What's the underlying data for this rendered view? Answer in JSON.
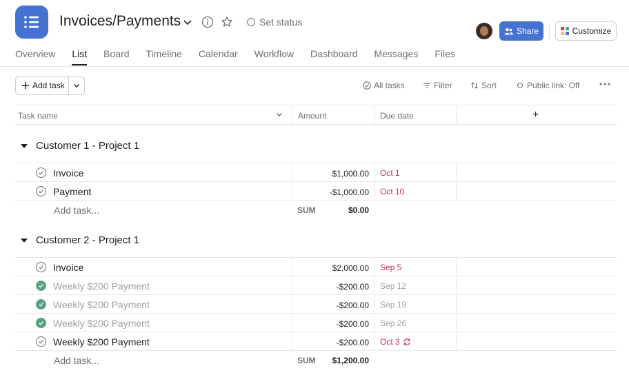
{
  "header": {
    "title": "Invoices/Payments",
    "set_status": "Set status",
    "share_label": "Share",
    "customize_label": "Customize",
    "accent_color": "#4573d2"
  },
  "tabs": [
    "Overview",
    "List",
    "Board",
    "Timeline",
    "Calendar",
    "Workflow",
    "Dashboard",
    "Messages",
    "Files"
  ],
  "active_tab": "List",
  "toolbar": {
    "add_task": "Add task",
    "all_tasks": "All tasks",
    "filter": "Filter",
    "sort": "Sort",
    "public_link": "Public link: Off"
  },
  "columns": {
    "task_name": "Task name",
    "amount": "Amount",
    "due_date": "Due date",
    "add_column": "+"
  },
  "sections": [
    {
      "title": "Customer 1 - Project 1",
      "tasks": [
        {
          "name": "Invoice",
          "amount": "$1,000.00",
          "due": "Oct 1",
          "done": false,
          "recurring": false
        },
        {
          "name": "Payment",
          "amount": "-$1,000.00",
          "due": "Oct 10",
          "done": false,
          "recurring": false
        }
      ],
      "add_task": "Add task...",
      "sum_label": "SUM",
      "sum_value": "$0.00"
    },
    {
      "title": "Customer 2 - Project 1",
      "tasks": [
        {
          "name": "Invoice",
          "amount": "$2,000.00",
          "due": "Sep 5",
          "done": false,
          "recurring": false
        },
        {
          "name": "Weekly $200 Payment",
          "amount": "-$200.00",
          "due": "Sep 12",
          "done": true,
          "recurring": false
        },
        {
          "name": "Weekly $200 Payment",
          "amount": "-$200.00",
          "due": "Sep 19",
          "done": true,
          "recurring": false
        },
        {
          "name": "Weekly $200 Payment",
          "amount": "-$200.00",
          "due": "Sep 26",
          "done": true,
          "recurring": false
        },
        {
          "name": "Weekly $200 Payment",
          "amount": "-$200.00",
          "due": "Oct 3",
          "done": false,
          "recurring": true
        }
      ],
      "add_task": "Add task...",
      "sum_label": "SUM",
      "sum_value": "$1,200.00"
    }
  ],
  "colors": {
    "overdue": "#c92f54",
    "completed_check": "#58a182",
    "muted_text": "#9ca0a3"
  }
}
